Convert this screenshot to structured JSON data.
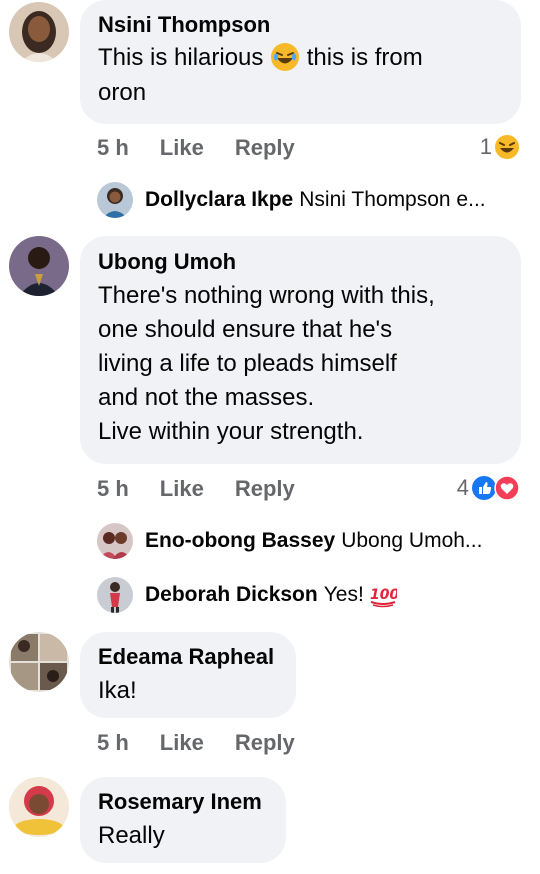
{
  "comments": [
    {
      "name": "Nsini Thompson",
      "lines": [
        "This is hilarious",
        "this is from",
        "oron"
      ],
      "time": "5 h",
      "like": "Like",
      "reply": "Reply",
      "reaction_count": "1",
      "replies": [
        {
          "name": "Dollyclara Ikpe",
          "text": "Nsini Thompson e..."
        }
      ]
    },
    {
      "name": "Ubong Umoh",
      "lines": [
        "There's nothing wrong with this,",
        "one should ensure that he's",
        "living a life to pleads himself",
        "and not the masses.",
        "Live within your strength."
      ],
      "time": "5 h",
      "like": "Like",
      "reply": "Reply",
      "reaction_count": "4",
      "replies": [
        {
          "name": "Eno-obong Bassey",
          "text": "Ubong Umoh..."
        },
        {
          "name": "Deborah Dickson",
          "text": "Yes!"
        }
      ]
    },
    {
      "name": "Edeama Rapheal",
      "lines": [
        "Ika!"
      ],
      "time": "5 h",
      "like": "Like",
      "reply": "Reply"
    },
    {
      "name": "Rosemary Inem",
      "lines": [
        "Really"
      ]
    }
  ],
  "colors": {
    "bubble": "#f0f2f5",
    "meta": "#65676b",
    "like_blue": "#1877f2",
    "love_red": "#f33e58",
    "haha_yellow": "#f7b928"
  },
  "icons": [
    "laughing-emoji-icon",
    "haha-reaction-icon",
    "like-reaction-icon",
    "love-reaction-icon",
    "hundred-points-emoji-icon"
  ]
}
